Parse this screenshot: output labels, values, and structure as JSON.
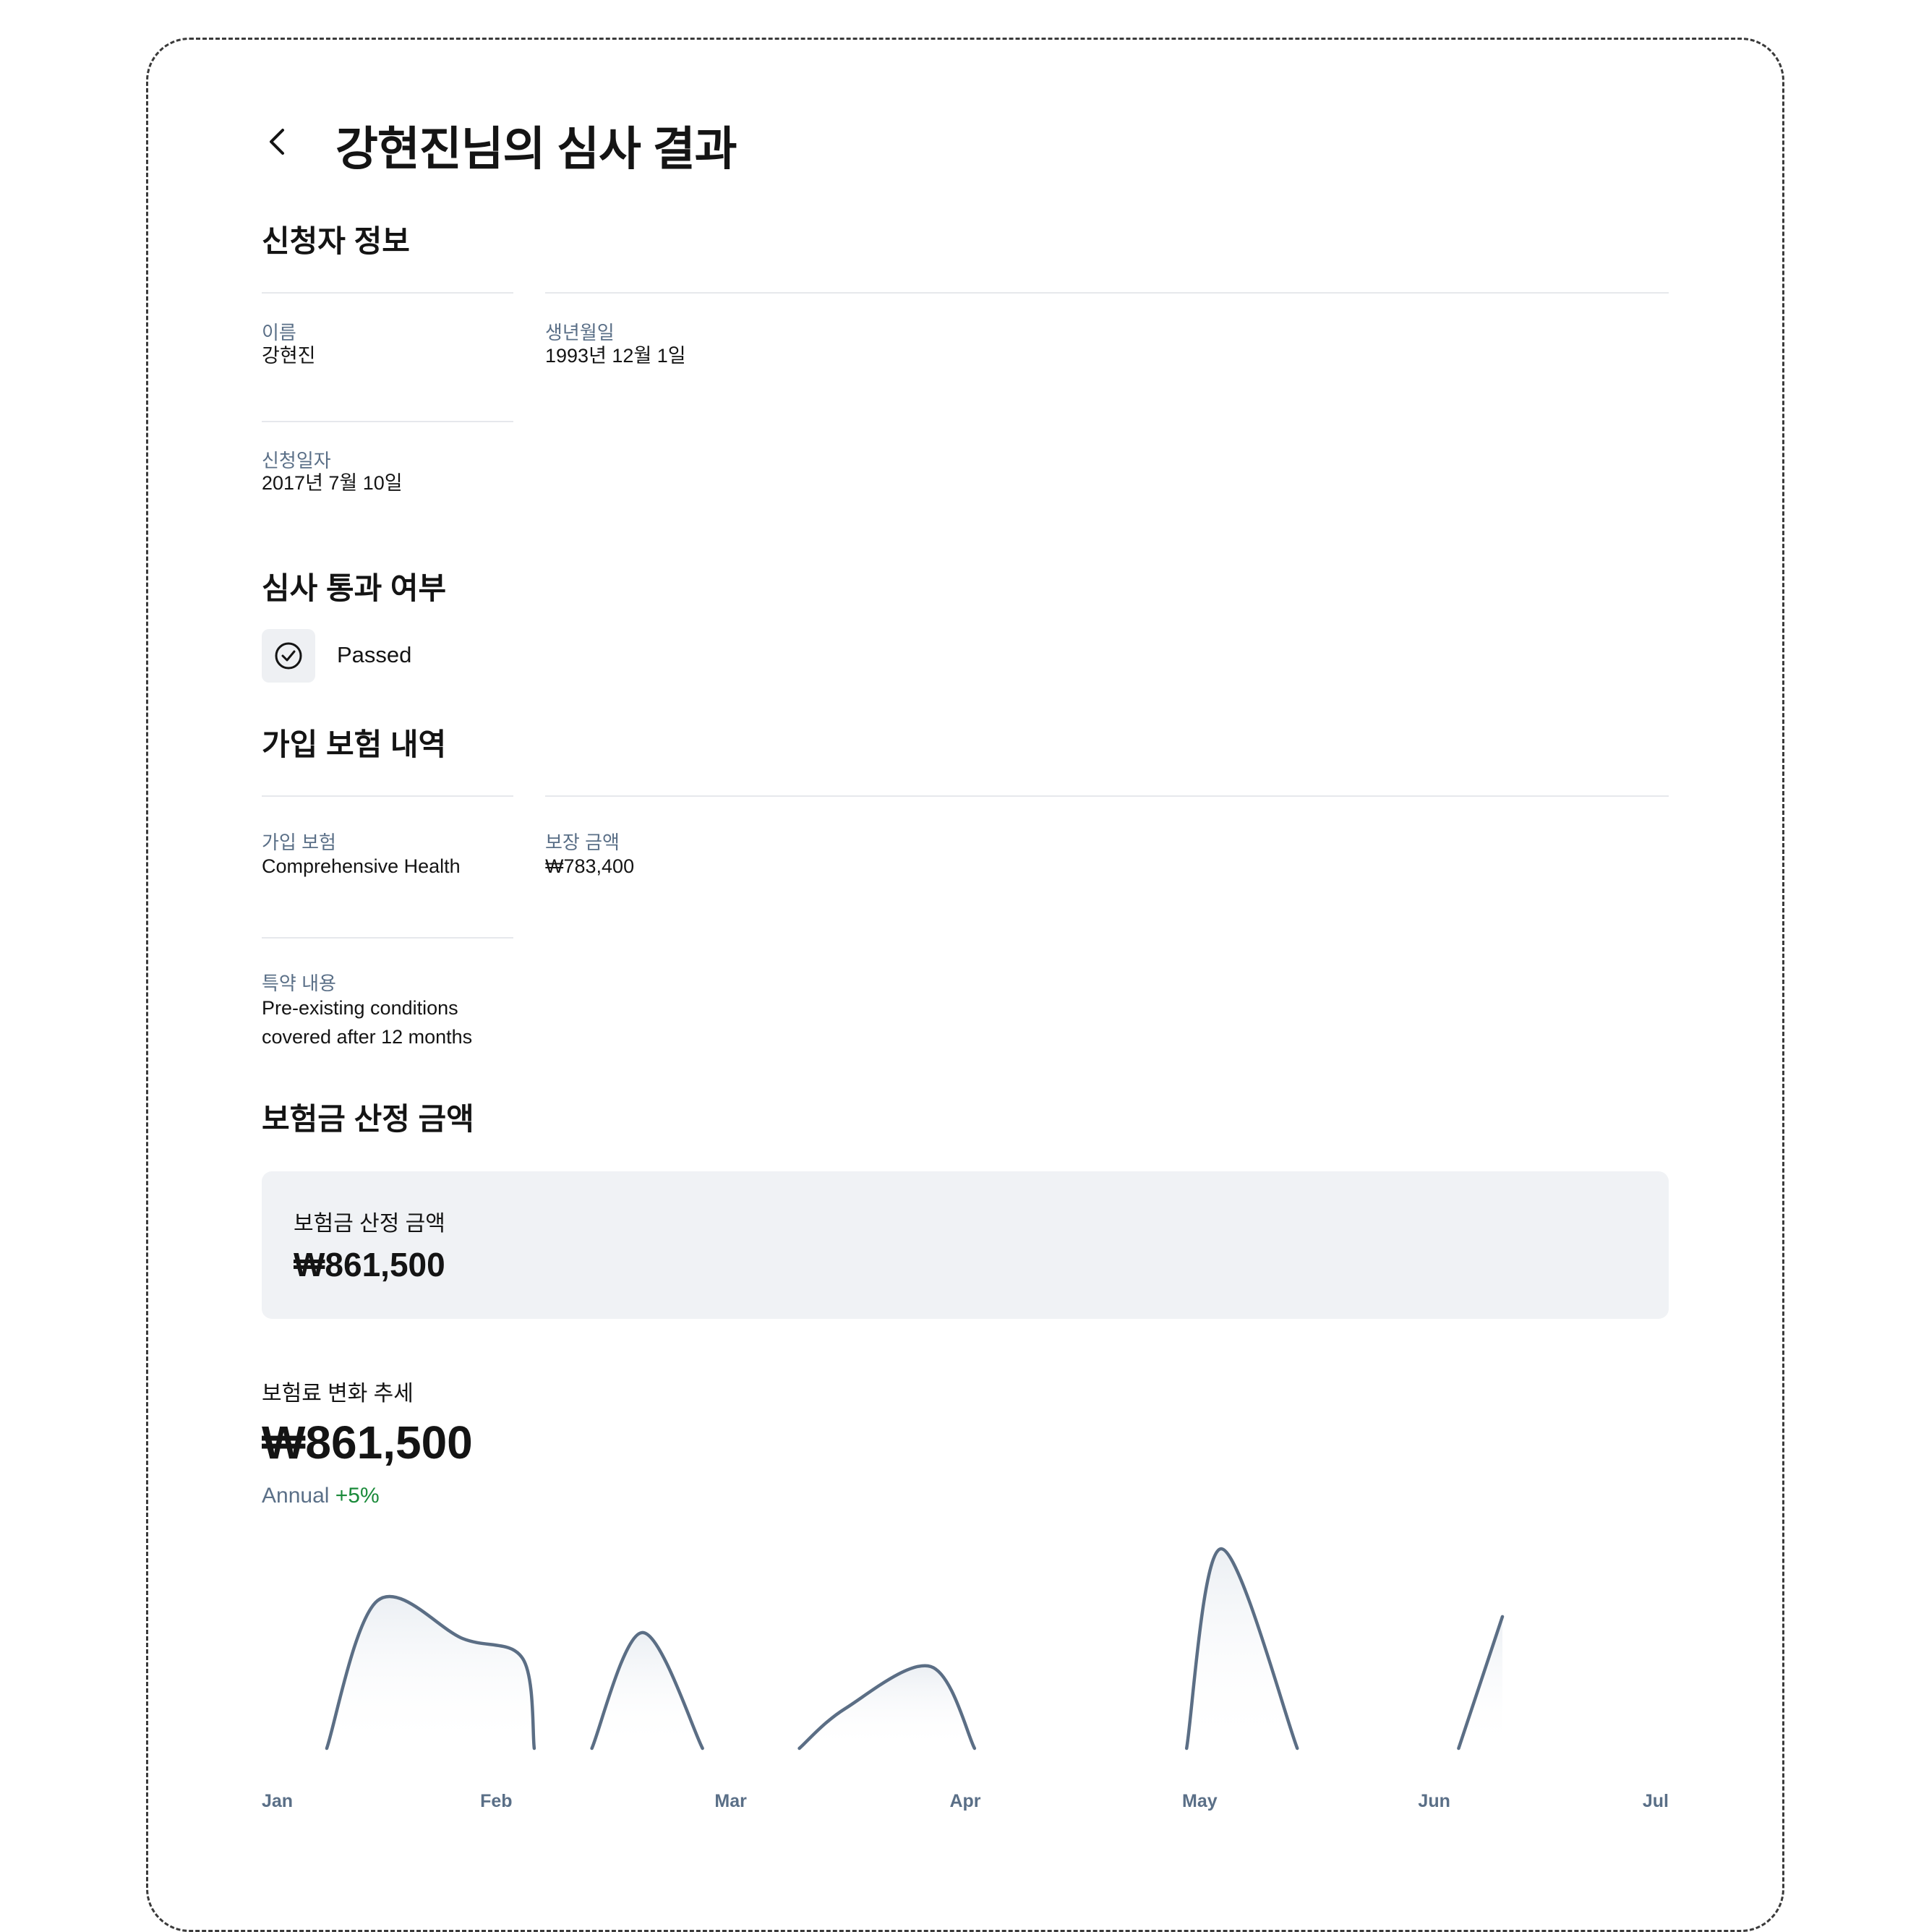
{
  "header": {
    "title": "강현진님의 심사 결과",
    "back_icon": "chevron-left-icon"
  },
  "applicant": {
    "section_title": "신청자 정보",
    "name_label": "이름",
    "name": "강현진",
    "birth_label": "생년월일",
    "birth": "1993년 12월 1일",
    "applied_label": "신청일자",
    "applied": "2017년 7월 10일"
  },
  "review": {
    "section_title": "심사 통과 여부",
    "status": "Passed",
    "icon": "check-circle-icon"
  },
  "insurance": {
    "section_title": "가입 보험 내역",
    "plan_label": "가입 보험",
    "plan": "Comprehensive Health",
    "coverage_label": "보장 금액",
    "coverage": "₩783,400",
    "rider_label": "특약 내용",
    "rider_line1": "Pre-existing conditions",
    "rider_line2": "covered after 12 months"
  },
  "payout": {
    "section_title": "보험금 산정 금액",
    "card_label": "보험금 산정 금액",
    "card_value": "₩861,500"
  },
  "trend": {
    "title": "보험료 변화 추세",
    "value": "₩861,500",
    "period": "Annual",
    "delta": "+5%"
  },
  "chart_data": {
    "type": "area",
    "color": "#5b6e85",
    "x_ticks": [
      "Jan",
      "Feb",
      "Mar",
      "Apr",
      "May",
      "Jun",
      "Jul"
    ],
    "series": [
      {
        "points": [
          [
            0.21,
            0
          ],
          [
            0.43,
            0.74
          ],
          [
            0.8,
            0.55
          ],
          [
            1.06,
            0.45
          ],
          [
            1.11,
            0
          ]
        ]
      },
      {
        "points": [
          [
            1.36,
            0
          ],
          [
            1.58,
            0.58
          ],
          [
            1.84,
            0
          ]
        ]
      },
      {
        "points": [
          [
            2.26,
            0
          ],
          [
            2.46,
            0.2
          ],
          [
            2.83,
            0.41
          ],
          [
            3.02,
            0
          ]
        ]
      },
      {
        "points": [
          [
            3.94,
            0
          ],
          [
            4.09,
            1.0
          ],
          [
            4.42,
            0
          ]
        ]
      },
      {
        "points": [
          [
            5.12,
            0
          ],
          [
            5.31,
            0.66
          ]
        ]
      }
    ]
  }
}
